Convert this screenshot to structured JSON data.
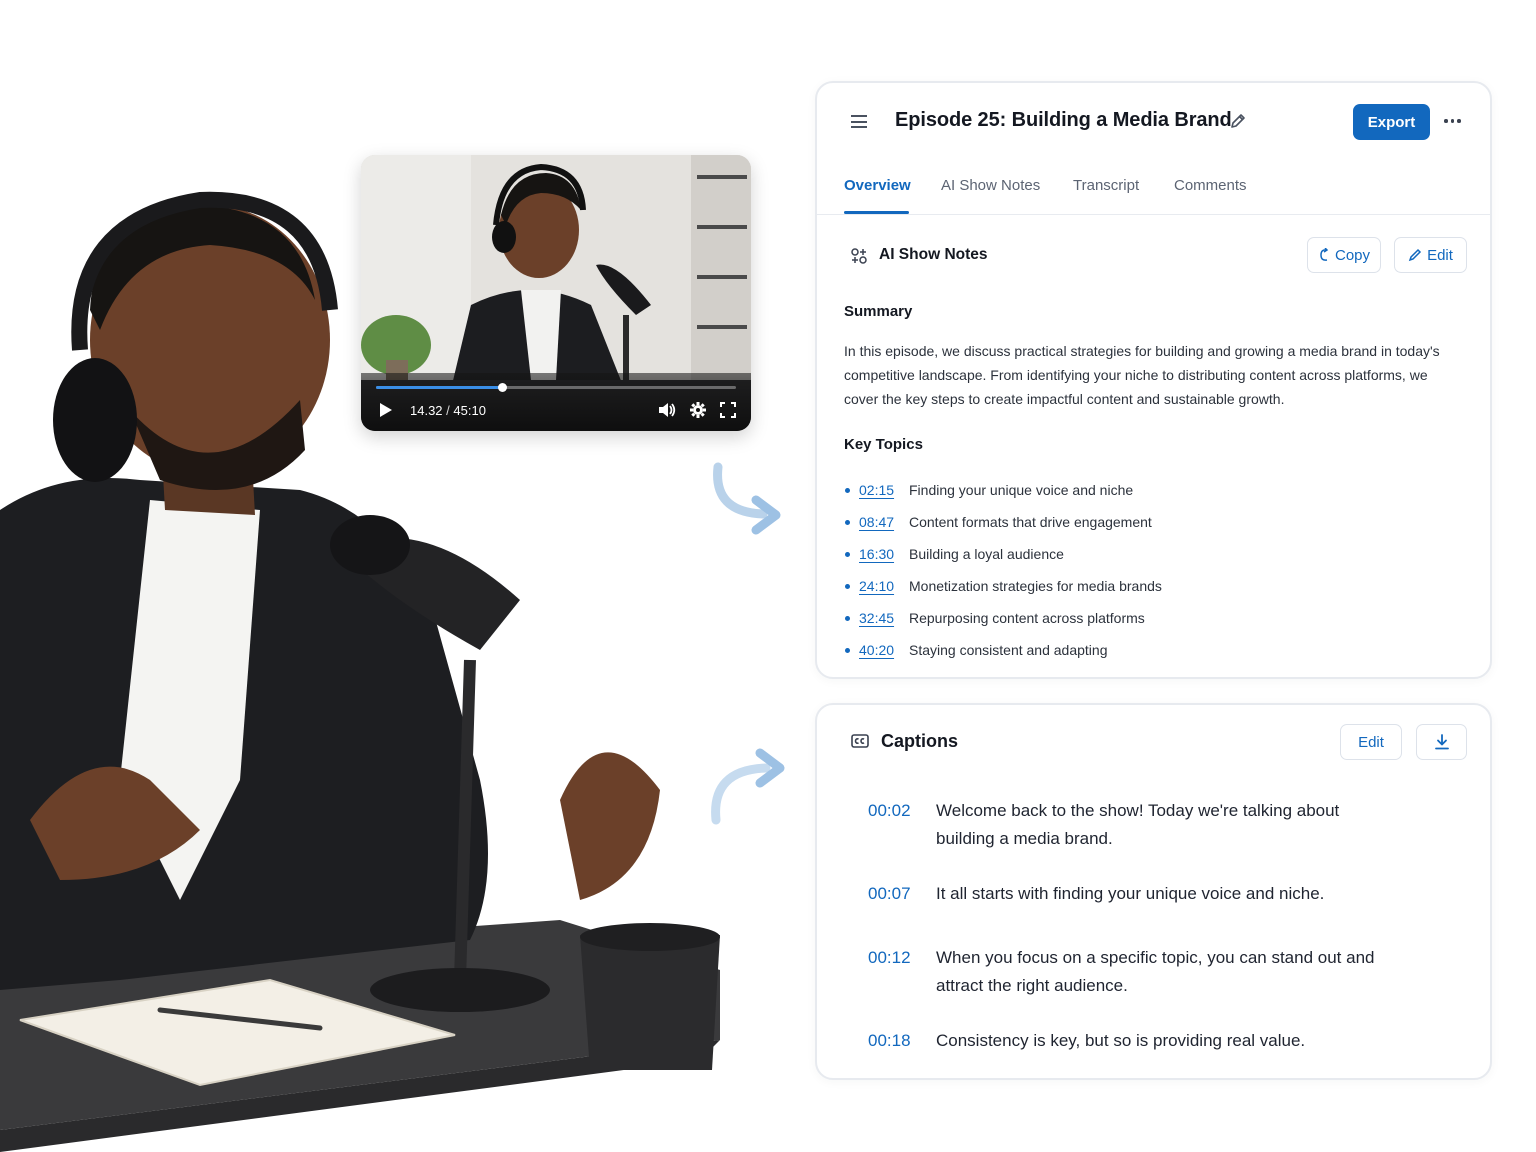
{
  "video": {
    "current_time": "14.32",
    "separator": "/",
    "duration": "45:10",
    "progress": 0.35
  },
  "notes_card": {
    "episode_title": "Episode 25: Building a Media Brand",
    "export_label": "Export",
    "tabs": [
      "Overview",
      "AI Show Notes",
      "Transcript",
      "Comments"
    ],
    "active_tab": "Overview",
    "section_title": "AI Show Notes",
    "copy_label": "Copy",
    "edit_label": "Edit",
    "summary_label": "Summary",
    "summary_text": "In this episode, we discuss practical strategies for building and growing a media brand in today's competitive landscape. From identifying your niche to distributing content across platforms, we cover the key steps to create impactful content and sustainable growth.",
    "key_topics_label": "Key Topics",
    "topics": [
      {
        "time": "02:15",
        "text": "Finding your unique voice and niche"
      },
      {
        "time": "08:47",
        "text": "Content formats that drive engagement"
      },
      {
        "time": "16:30",
        "text": "Building a loyal audience"
      },
      {
        "time": "24:10",
        "text": "Monetization strategies for media brands"
      },
      {
        "time": "32:45",
        "text": "Repurposing content across platforms"
      },
      {
        "time": "40:20",
        "text": "Staying consistent and adapting"
      }
    ]
  },
  "captions_card": {
    "title": "Captions",
    "edit_label": "Edit",
    "captions": [
      {
        "time": "00:02",
        "text": "Welcome back to the show! Today we're talking about building a media brand."
      },
      {
        "time": "00:07",
        "text": "It all starts with finding your unique voice and niche."
      },
      {
        "time": "00:12",
        "text": "When you focus on a specific topic, you can stand out and attract the right audience."
      },
      {
        "time": "00:18",
        "text": "Consistency is key, but so is providing real value."
      }
    ]
  },
  "colors": {
    "accent": "#1268be",
    "card_border": "#e7eaef",
    "text_primary": "#141821"
  },
  "icons": [
    "menu-icon",
    "pencil-icon",
    "more-icon",
    "ai-sparkle-icon",
    "copy-icon",
    "edit-icon",
    "closed-captions-icon",
    "download-icon",
    "play-icon",
    "volume-icon",
    "settings-icon",
    "fullscreen-icon"
  ]
}
